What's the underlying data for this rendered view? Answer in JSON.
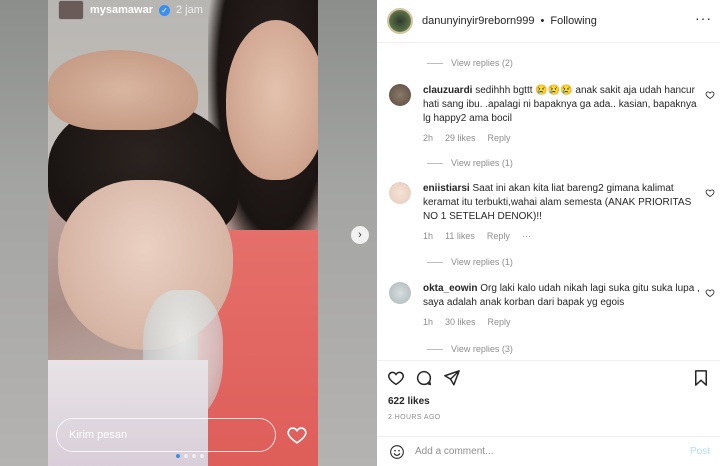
{
  "story": {
    "username": "mysamawar",
    "time": "2 jam",
    "reply_placeholder": "Kirim pesan",
    "next_symbol": "›"
  },
  "post": {
    "username": "danunyinyir9reborn999",
    "separator": "•",
    "following": "Following",
    "more": "···",
    "likes": "622 likes",
    "time_ago": "2 HOURS AGO",
    "add_comment": "Add a comment...",
    "post_label": "Post"
  },
  "comments": [
    {
      "view_replies_before": "View replies (2)",
      "username": "clauzuardi",
      "text": "sedihhh bgttt 😢😢😢 anak sakit aja udah hancur hati sang ibu. .apalagi ni bapaknya ga ada.. kasian, bapaknya lg happy2 ama bocil",
      "time": "2h",
      "likes": "29 likes",
      "reply": "Reply",
      "view_replies": "View replies (1)"
    },
    {
      "username": "eniistiarsi",
      "text": "Saat ini akan kita liat bareng2 gimana kalimat keramat itu terbukti,wahai alam semesta (ANAK PRIORITAS NO 1 SETELAH DENOK)!!",
      "time": "1h",
      "likes": "11 likes",
      "reply": "Reply",
      "more": "···",
      "view_replies": "View replies (1)"
    },
    {
      "username": "okta_eowin",
      "text": "Org laki kalo udah nikah lagi suka gitu suka lupa , saya adalah anak korban dari bapak yg egois",
      "time": "1h",
      "likes": "30 likes",
      "reply": "Reply",
      "view_replies": "View replies (3)"
    }
  ],
  "colors": {
    "accent": "#3a8ef0",
    "text": "#262626",
    "muted": "#8e8e8e",
    "post_disabled": "#b2dffc"
  },
  "icons": [
    "heart-icon",
    "comment-icon",
    "share-icon",
    "bookmark-icon",
    "smile-icon",
    "verified-icon"
  ]
}
